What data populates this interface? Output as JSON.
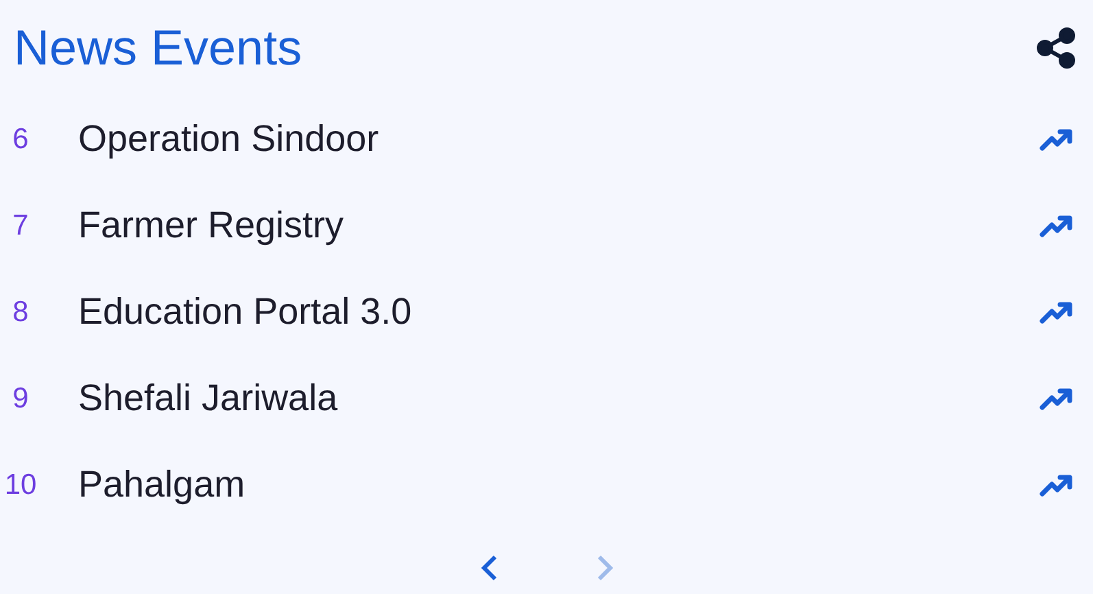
{
  "title": "News Events",
  "items": [
    {
      "rank": "6",
      "label": "Operation Sindoor"
    },
    {
      "rank": "7",
      "label": "Farmer Registry"
    },
    {
      "rank": "8",
      "label": "Education Portal 3.0"
    },
    {
      "rank": "9",
      "label": "Shefali Jariwala"
    },
    {
      "rank": "10",
      "label": "Pahalgam"
    }
  ],
  "pager": {
    "previous_disabled": false,
    "next_disabled": true
  }
}
